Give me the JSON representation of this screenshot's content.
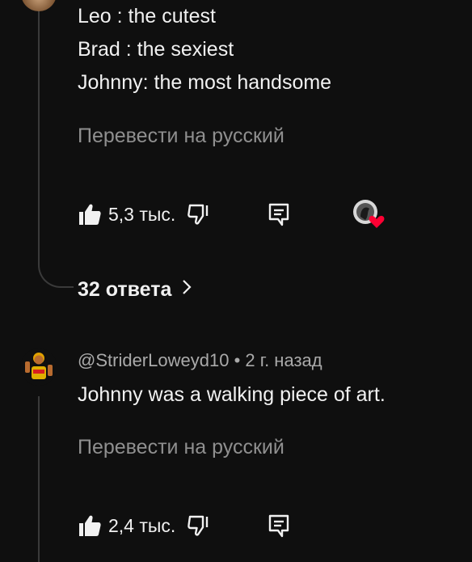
{
  "comment1": {
    "lines": [
      "Leo : the cutest",
      "Brad : the sexiest",
      "Johnny: the most handsome"
    ],
    "translate_label": "Перевести на русский",
    "likes": "5,3 тыс.",
    "replies_label": "32 ответа"
  },
  "comment2": {
    "author": "@StriderLoweyd10",
    "separator": "•",
    "time": "2 г. назад",
    "text": "Johnny was a walking piece of art.",
    "translate_label": "Перевести на русский",
    "likes": "2,4 тыс."
  },
  "colors": {
    "background": "#0f0f0f",
    "text": "#f1f1f1",
    "muted": "#aaaaaa",
    "heart": "#ff0033"
  },
  "icons": [
    "like-icon",
    "dislike-icon",
    "reply-icon",
    "creator-heart-icon",
    "chevron-right-icon"
  ]
}
